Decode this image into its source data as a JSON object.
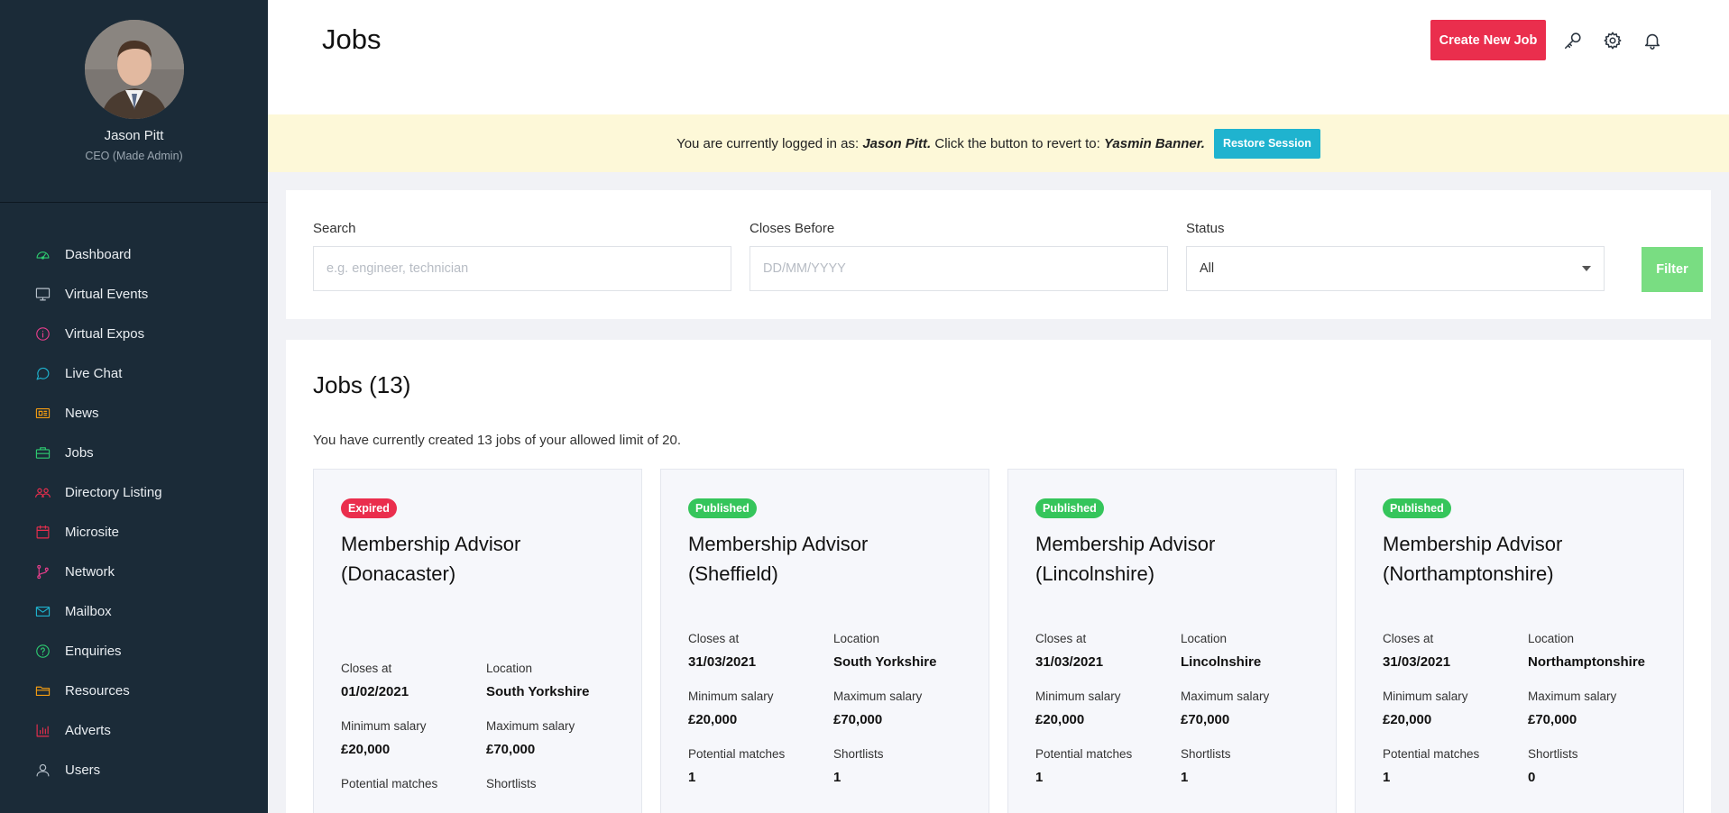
{
  "sidebar": {
    "user": {
      "name": "Jason Pitt",
      "role": "CEO (Made Admin)"
    },
    "items": [
      {
        "label": "Dashboard",
        "icon": "dashboard-icon",
        "color": "#2ecc71"
      },
      {
        "label": "Virtual Events",
        "icon": "monitor-icon",
        "color": "#b8c2cc"
      },
      {
        "label": "Virtual Expos",
        "icon": "info-icon",
        "color": "#e83e8c"
      },
      {
        "label": "Live Chat",
        "icon": "chat-icon",
        "color": "#1fb3cf"
      },
      {
        "label": "News",
        "icon": "newspaper-icon",
        "color": "#f39c12"
      },
      {
        "label": "Jobs",
        "icon": "briefcase-icon",
        "color": "#2ecc71"
      },
      {
        "label": "Directory Listing",
        "icon": "users-icon",
        "color": "#ea2e4d"
      },
      {
        "label": "Microsite",
        "icon": "calendar-icon",
        "color": "#ea2e4d"
      },
      {
        "label": "Network",
        "icon": "branch-icon",
        "color": "#e83e8c"
      },
      {
        "label": "Mailbox",
        "icon": "mail-icon",
        "color": "#1fb3cf"
      },
      {
        "label": "Enquiries",
        "icon": "question-icon",
        "color": "#2ecc71"
      },
      {
        "label": "Resources",
        "icon": "folder-icon",
        "color": "#f39c12"
      },
      {
        "label": "Adverts",
        "icon": "bar-chart-icon",
        "color": "#ea2e4d"
      },
      {
        "label": "Users",
        "icon": "user-icon",
        "color": "#b8c2cc"
      }
    ]
  },
  "header": {
    "title": "Jobs",
    "create_label": "Create New Job"
  },
  "banner": {
    "prefix": "You are currently logged in as: ",
    "current_user": "Jason Pitt.",
    "middle": " Click the button to revert to: ",
    "revert_user": "Yasmin Banner.",
    "button_label": "Restore Session"
  },
  "filters": {
    "search": {
      "label": "Search",
      "placeholder": "e.g. engineer, technician",
      "value": ""
    },
    "closes_before": {
      "label": "Closes Before",
      "placeholder": "DD/MM/YYYY",
      "value": ""
    },
    "status": {
      "label": "Status",
      "value": "All"
    },
    "filter_label": "Filter"
  },
  "jobs": {
    "heading": "Jobs (13)",
    "summary": "You have currently created 13 jobs of your allowed limit of 20.",
    "labels": {
      "closes_at": "Closes at",
      "location": "Location",
      "min_salary": "Minimum salary",
      "max_salary": "Maximum salary",
      "potential_matches": "Potential matches",
      "shortlists": "Shortlists"
    },
    "items": [
      {
        "status": "Expired",
        "title": "Membership Advisor (Donacaster)",
        "closes_at": "01/02/2021",
        "location": "South Yorkshire",
        "min_salary": "£20,000",
        "max_salary": "£70,000",
        "potential_matches": "",
        "shortlists": ""
      },
      {
        "status": "Published",
        "title": "Membership Advisor (Sheffield)",
        "closes_at": "31/03/2021",
        "location": "South Yorkshire",
        "min_salary": "£20,000",
        "max_salary": "£70,000",
        "potential_matches": "1",
        "shortlists": "1"
      },
      {
        "status": "Published",
        "title": "Membership Advisor (Lincolnshire)",
        "closes_at": "31/03/2021",
        "location": "Lincolnshire",
        "min_salary": "£20,000",
        "max_salary": "£70,000",
        "potential_matches": "1",
        "shortlists": "1"
      },
      {
        "status": "Published",
        "title": "Membership Advisor (Northamptonshire)",
        "closes_at": "31/03/2021",
        "location": "Northamptonshire",
        "min_salary": "£20,000",
        "max_salary": "£70,000",
        "potential_matches": "1",
        "shortlists": "0"
      }
    ]
  }
}
